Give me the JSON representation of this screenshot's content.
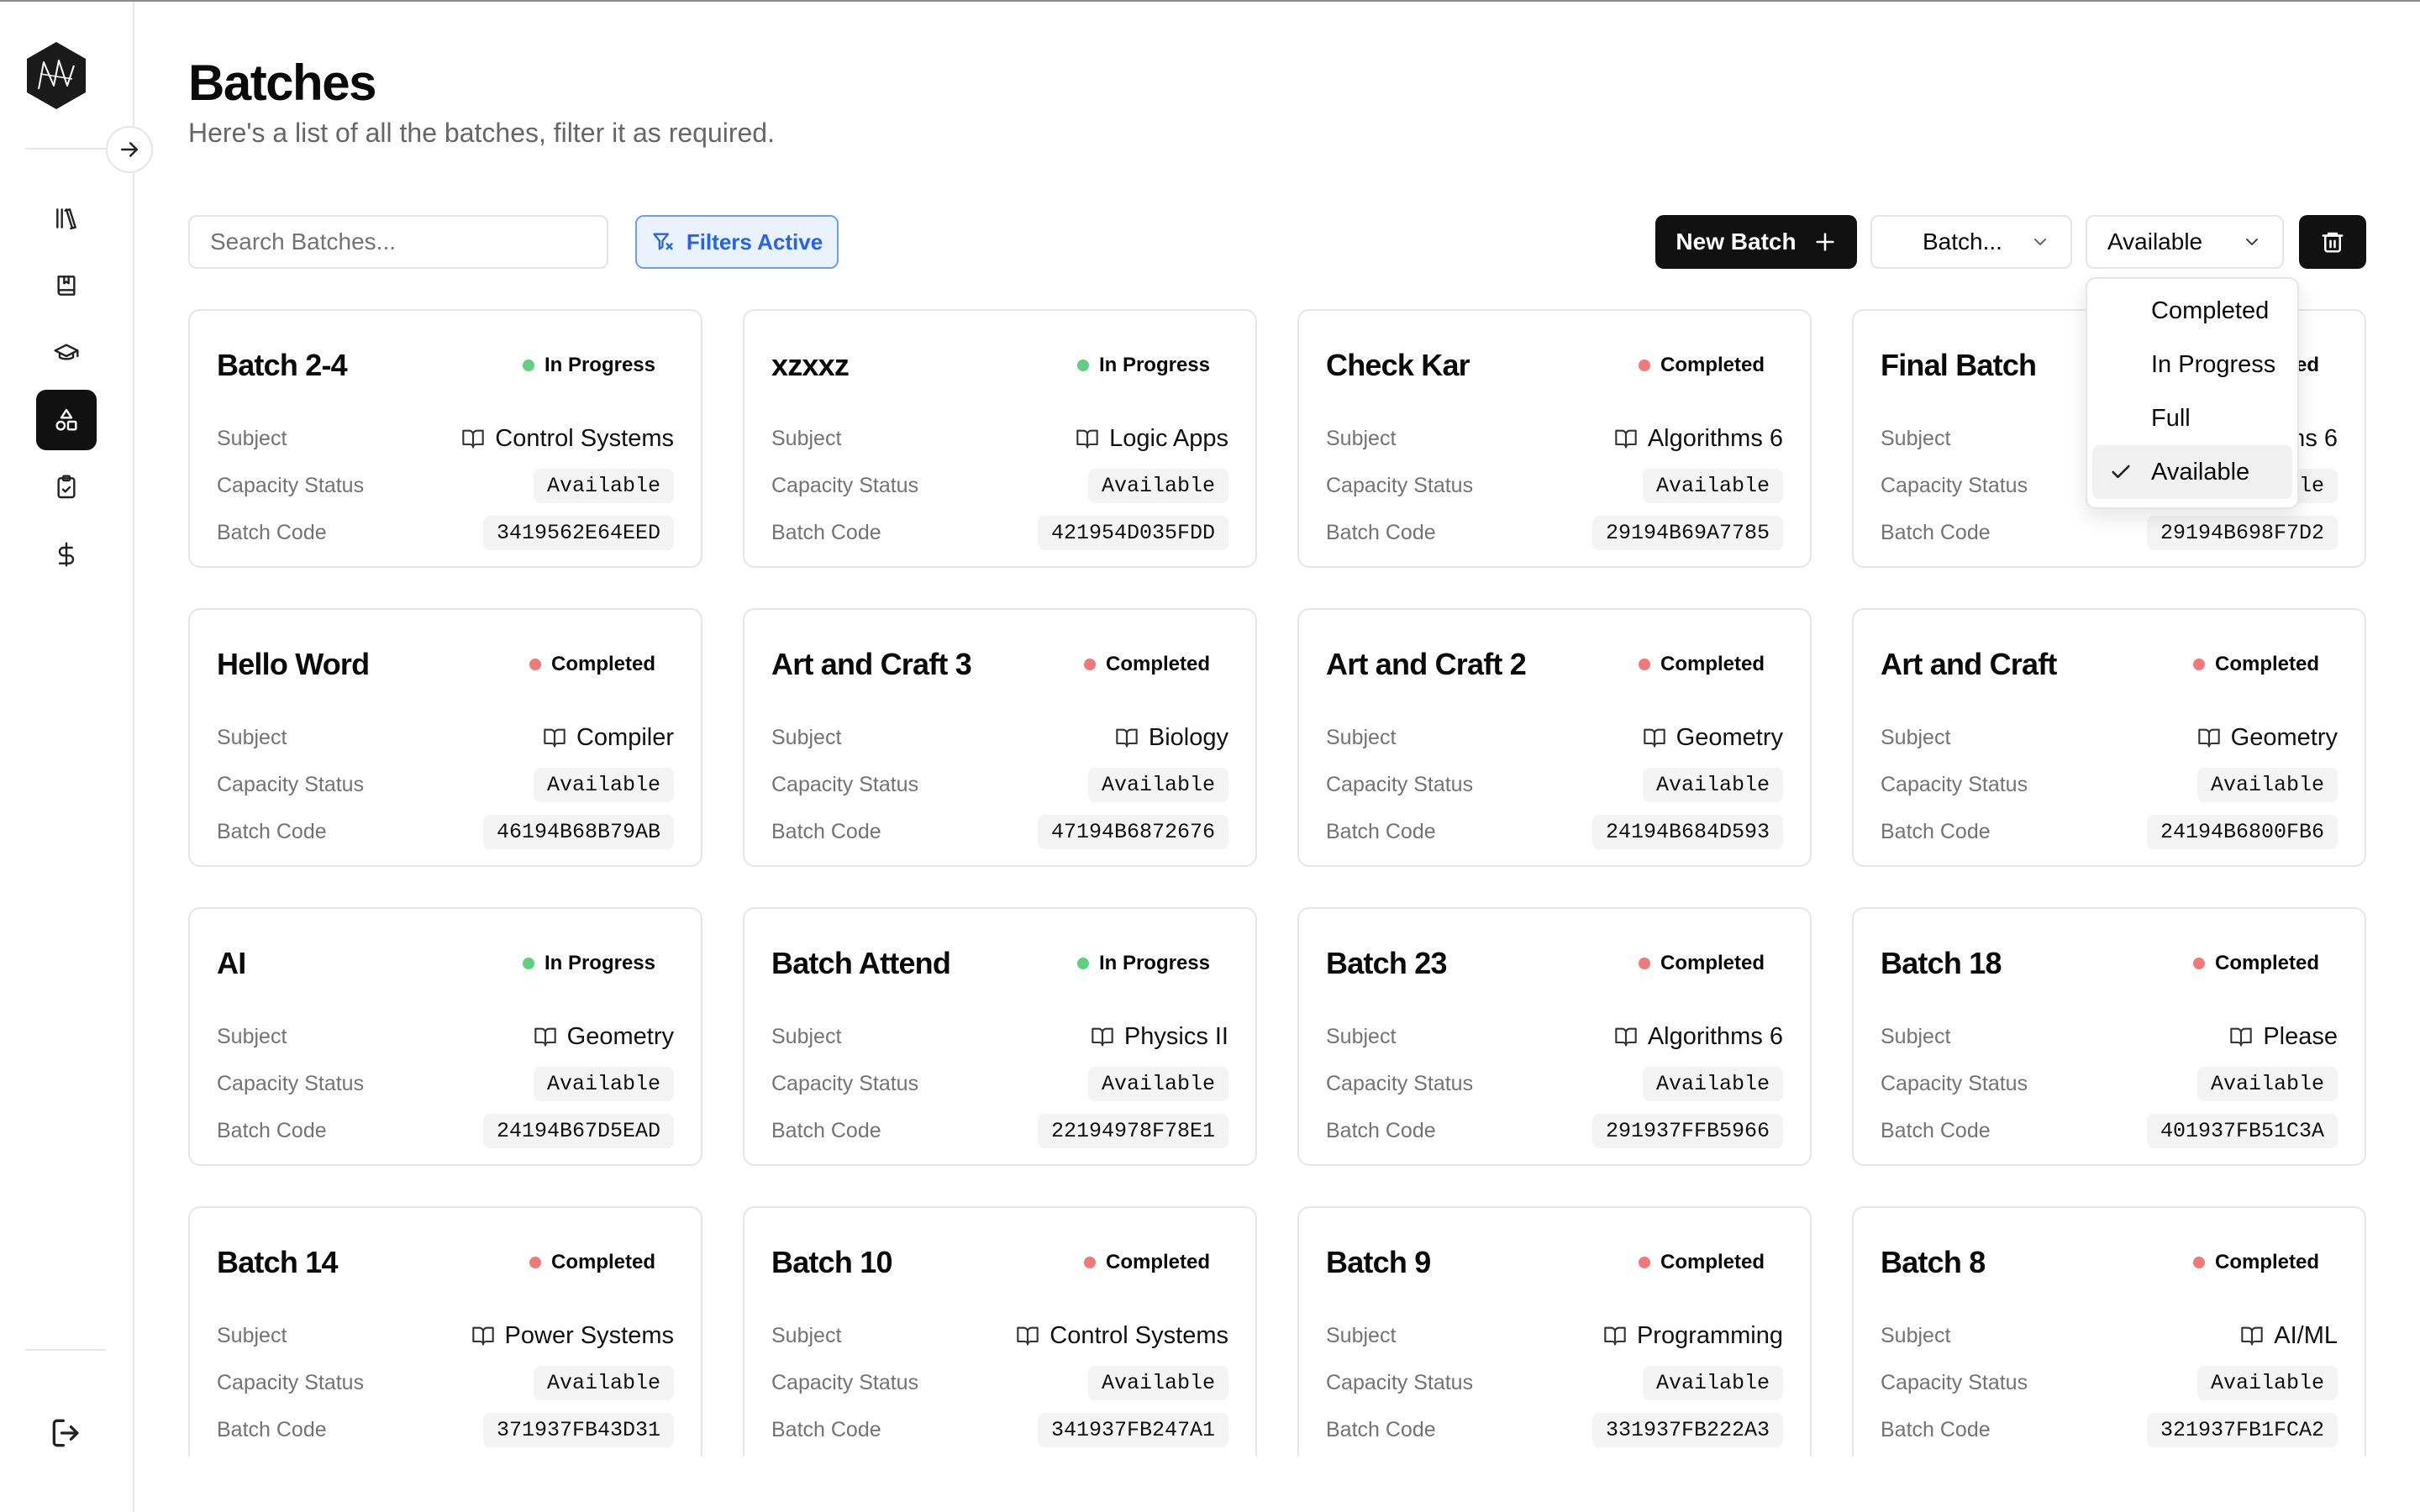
{
  "page": {
    "title": "Batches",
    "subtitle": "Here's a list of all the batches, filter it as required."
  },
  "sidebar": {
    "icons": [
      "library-icon",
      "book-marked-icon",
      "graduation-cap-icon",
      "shapes-icon",
      "clipboard-check-icon",
      "dollar-icon"
    ],
    "active_index": 3,
    "expand_icon": "arrow-right-icon",
    "logout_icon": "log-out-icon"
  },
  "toolbar": {
    "search_placeholder": "Search Batches...",
    "filters_label": "Filters Active",
    "new_batch_label": "New Batch",
    "batch_select_value": "Batch...",
    "status_select_value": "Available"
  },
  "status_menu": {
    "options": [
      "Completed",
      "In Progress",
      "Full",
      "Available"
    ],
    "selected": "Available"
  },
  "labels": {
    "subject": "Subject",
    "capacity": "Capacity Status",
    "code": "Batch Code"
  },
  "colors": {
    "in_progress_dot": "#5fd07f",
    "completed_dot": "#f07a7a",
    "filter_accent": "#2563eb",
    "primary": "#111111"
  },
  "batches": [
    {
      "title": "Batch 2-4",
      "status": "In Progress",
      "subject": "Control Systems",
      "capacity": "Available",
      "code": "3419562E64EED"
    },
    {
      "title": "xzxxz",
      "status": "In Progress",
      "subject": "Logic Apps",
      "capacity": "Available",
      "code": "421954D035FDD"
    },
    {
      "title": "Check Kar",
      "status": "Completed",
      "subject": "Algorithms 6",
      "capacity": "Available",
      "code": "29194B69A7785"
    },
    {
      "title": "Final Batch",
      "status": "Completed",
      "subject": "Algorithms 6",
      "capacity": "Available",
      "code": "29194B698F7D2"
    },
    {
      "title": "Hello Word",
      "status": "Completed",
      "subject": "Compiler",
      "capacity": "Available",
      "code": "46194B68B79AB"
    },
    {
      "title": "Art and Craft 3",
      "status": "Completed",
      "subject": "Biology",
      "capacity": "Available",
      "code": "47194B6872676"
    },
    {
      "title": "Art and Craft 2",
      "status": "Completed",
      "subject": "Geometry",
      "capacity": "Available",
      "code": "24194B684D593"
    },
    {
      "title": "Art and Craft",
      "status": "Completed",
      "subject": "Geometry",
      "capacity": "Available",
      "code": "24194B6800FB6"
    },
    {
      "title": "AI",
      "status": "In Progress",
      "subject": "Geometry",
      "capacity": "Available",
      "code": "24194B67D5EAD"
    },
    {
      "title": "Batch Attend",
      "status": "In Progress",
      "subject": "Physics II",
      "capacity": "Available",
      "code": "22194978F78E1"
    },
    {
      "title": "Batch 23",
      "status": "Completed",
      "subject": "Algorithms 6",
      "capacity": "Available",
      "code": "291937FFB5966"
    },
    {
      "title": "Batch 18",
      "status": "Completed",
      "subject": "Please",
      "capacity": "Available",
      "code": "401937FB51C3A"
    },
    {
      "title": "Batch 14",
      "status": "Completed",
      "subject": "Power Systems",
      "capacity": "Available",
      "code": "371937FB43D31"
    },
    {
      "title": "Batch 10",
      "status": "Completed",
      "subject": "Control Systems",
      "capacity": "Available",
      "code": "341937FB247A1"
    },
    {
      "title": "Batch 9",
      "status": "Completed",
      "subject": "Programming",
      "capacity": "Available",
      "code": "331937FB222A3"
    },
    {
      "title": "Batch 8",
      "status": "Completed",
      "subject": "AI/ML",
      "capacity": "Available",
      "code": "321937FB1FCA2"
    }
  ]
}
